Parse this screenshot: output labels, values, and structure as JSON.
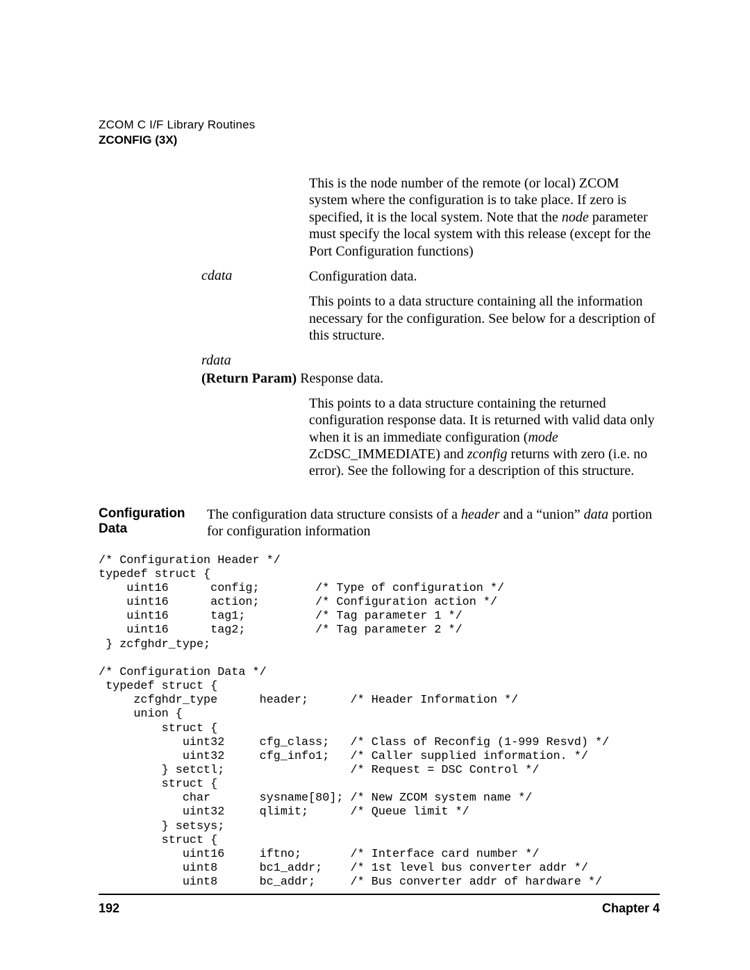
{
  "header": {
    "line1": "ZCOM C I/F Library Routines",
    "line2": "ZCONFIG (3X)"
  },
  "params": {
    "node_desc_p1_a": "This is the node number of the remote (or local) ZCOM system where the configuration is to take place. If zero is specified, it is the local system. Note that the ",
    "node_desc_p1_b": "node",
    "node_desc_p1_c": " parameter must specify the local system with this release (except for the Port Configuration functions)",
    "cdata_label": "cdata",
    "cdata_brief": "Configuration data.",
    "cdata_desc": "This points to a data structure containing all the information necessary for the configuration. See below for a description of this structure.",
    "rdata_label": "rdata",
    "rdata_tag_a": "(Return Param) ",
    "rdata_tag_b": "Response data.",
    "rdata_desc_a": "This points to a data structure containing the returned configuration response data. It is returned with valid data only when it is an immediate configuration (",
    "rdata_desc_b": "mode",
    "rdata_desc_c": " ZcDSC_IMMEDIATE) and ",
    "rdata_desc_d": "zconfig",
    "rdata_desc_e": " returns with zero (i.e. no error). See the following for a description of this structure."
  },
  "section": {
    "heading": "Configuration Data",
    "text_a": "The configuration data structure consists of a ",
    "text_b": "header",
    "text_c": " and a “union” ",
    "text_d": "data",
    "text_e": " portion for configuration information"
  },
  "code": "/* Configuration Header */\ntypedef struct {\n    uint16      config;        /* Type of configuration */\n    uint16      action;        /* Configuration action */\n    uint16      tag1;          /* Tag parameter 1 */\n    uint16      tag2;          /* Tag parameter 2 */\n } zcfghdr_type;\n\n/* Configuration Data */\n typedef struct {\n     zcfghdr_type      header;      /* Header Information */\n     union {\n         struct {\n            uint32     cfg_class;   /* Class of Reconfig (1-999 Resvd) */\n            uint32     cfg_info1;   /* Caller supplied information. */\n         } setctl;                  /* Request = DSC Control */\n         struct {\n            char       sysname[80]; /* New ZCOM system name */\n            uint32     qlimit;      /* Queue limit */\n         } setsys;\n         struct {\n            uint16     iftno;       /* Interface card number */\n            uint8      bc1_addr;    /* 1st level bus converter addr */\n            uint8      bc_addr;     /* Bus converter addr of hardware */",
  "footer": {
    "page": "192",
    "chapter": "Chapter 4"
  }
}
